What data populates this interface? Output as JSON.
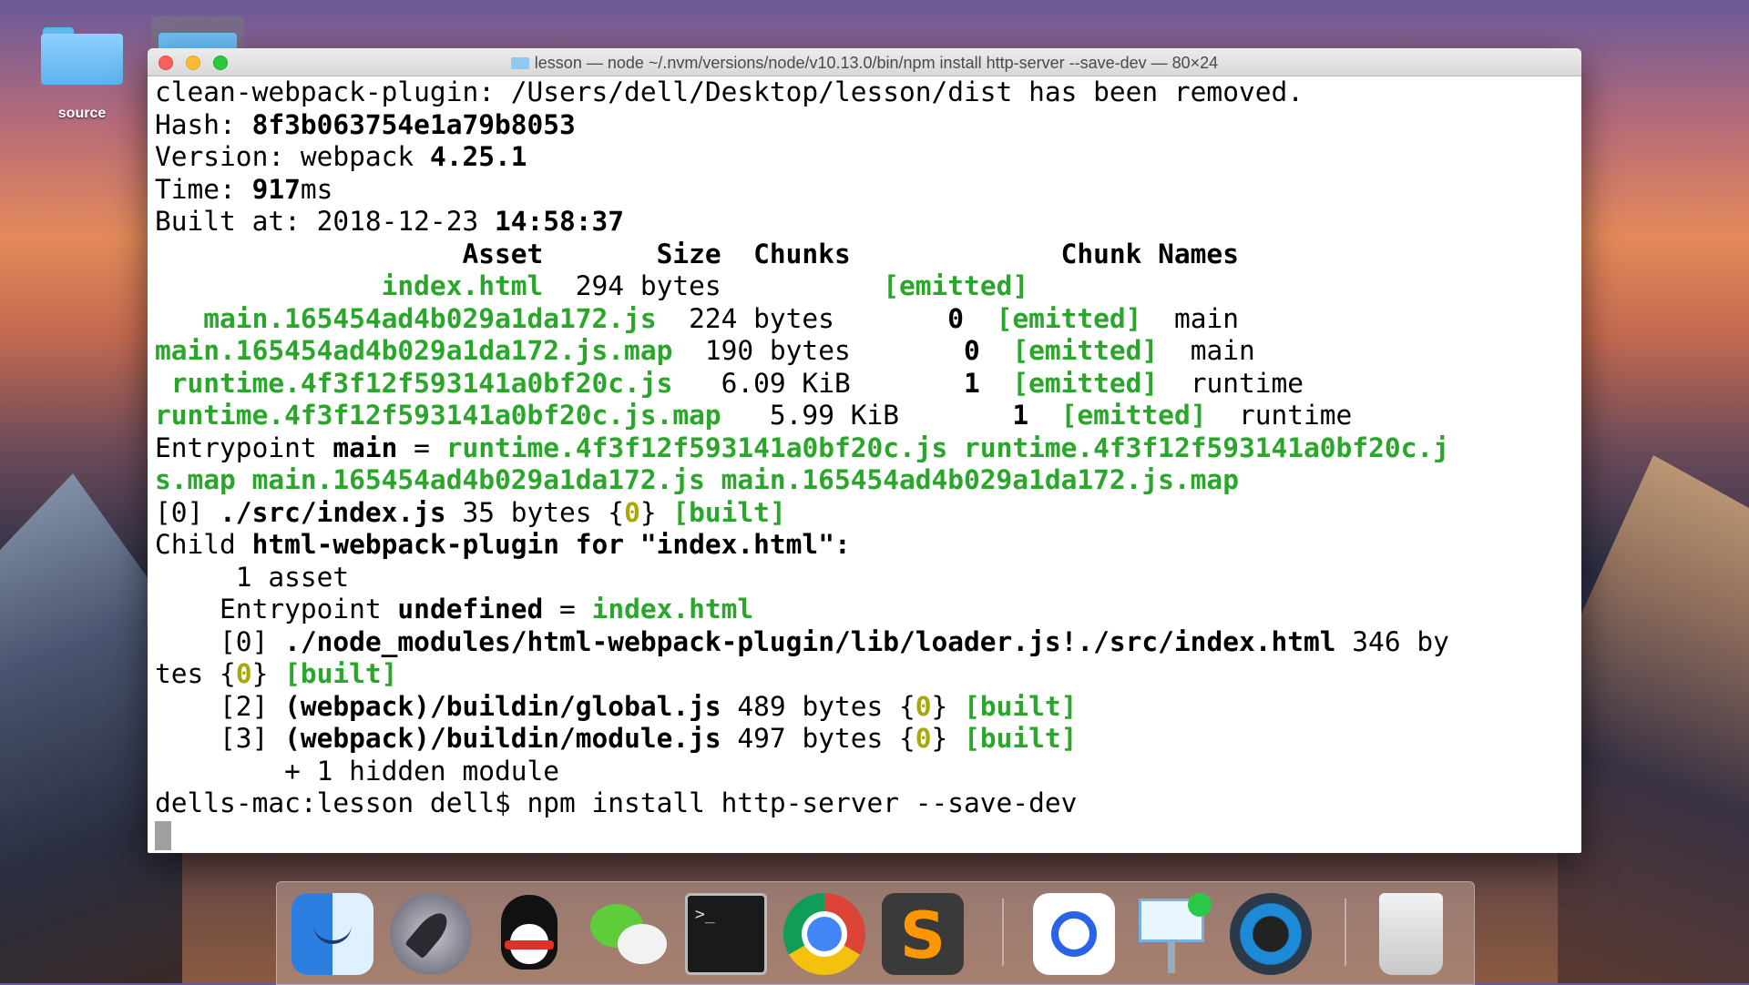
{
  "desktop": {
    "folder_label": "source"
  },
  "window": {
    "title": "lesson — node ~/.nvm/versions/node/v10.13.0/bin/npm install http-server --save-dev — 80×24"
  },
  "terminal": {
    "l1": "clean-webpack-plugin: /Users/dell/Desktop/lesson/dist has been removed.",
    "hash_label": "Hash: ",
    "hash": "8f3b063754e1a79b8053",
    "version_label": "Version: webpack ",
    "version": "4.25.1",
    "time_label": "Time: ",
    "time_value": "917",
    "time_unit": "ms",
    "built_label": "Built at: 2018-12-23 ",
    "built_time": "14:58:37",
    "table_header": "                   Asset       Size  Chunks             Chunk Names",
    "rows": [
      {
        "asset": "              index.html",
        "size": "  294 bytes",
        "chunks": "        ",
        "status": "  [emitted]",
        "name": ""
      },
      {
        "asset": "   main.165454ad4b029a1da172.js",
        "size": "  224 bytes",
        "chunks": "       0",
        "status": "  [emitted]",
        "name": "  main"
      },
      {
        "asset": "main.165454ad4b029a1da172.js.map",
        "size": "  190 bytes",
        "chunks": "       0",
        "status": "  [emitted]",
        "name": "  main"
      },
      {
        "asset": " runtime.4f3f12f593141a0bf20c.js",
        "size": "   6.09 KiB",
        "chunks": "       1",
        "status": "  [emitted]",
        "name": "  runtime"
      },
      {
        "asset": "runtime.4f3f12f593141a0bf20c.js.map",
        "size": "   5.99 KiB",
        "chunks": "       1",
        "status": "  [emitted]",
        "name": "  runtime"
      }
    ],
    "entry_label": "Entrypoint ",
    "entry_name": "main",
    "entry_eq": " = ",
    "entry_files_1": "runtime.4f3f12f593141a0bf20c.js runtime.4f3f12f593141a0bf20c.j",
    "entry_files_2": "s.map main.165454ad4b029a1da172.js main.165454ad4b029a1da172.js.map",
    "mod0_prefix": "[0] ",
    "mod0_path": "./src/index.js",
    "mod0_size": " 35 bytes {",
    "mod0_chunk": "0",
    "mod0_close": "} ",
    "built_tag": "[built]",
    "child_label": "Child ",
    "child_name": "html-webpack-plugin for \"index.html\":",
    "asset_count": "     1 asset",
    "child_entry_label": "    Entrypoint ",
    "child_entry_name": "undefined",
    "child_entry_file": "index.html",
    "cmod0_prefix": "    [0] ",
    "cmod0_path": "./node_modules/html-webpack-plugin/lib/loader.js!./src/index.html",
    "cmod0_size": " 346 by",
    "cmod0_wrap": "tes {",
    "cmod2_prefix": "    [2] ",
    "cmod2_path": "(webpack)/buildin/global.js",
    "cmod2_size": " 489 bytes {",
    "cmod3_prefix": "    [3] ",
    "cmod3_path": "(webpack)/buildin/module.js",
    "cmod3_size": " 497 bytes {",
    "hidden": "        + 1 hidden module",
    "prompt": "dells-mac:lesson dell$ npm install http-server --save-dev"
  },
  "colors": {
    "green": "#2aa62a",
    "yellow": "#a8a80a"
  },
  "dock": {
    "items": [
      "finder-icon",
      "launchpad-icon",
      "qq-icon",
      "wechat-icon",
      "terminal-icon",
      "chrome-icon",
      "sublime-text-icon",
      "baidu-netdisk-icon",
      "keynote-icon",
      "quicktime-icon",
      "trash-icon"
    ],
    "terminal_glyph": ">_"
  }
}
